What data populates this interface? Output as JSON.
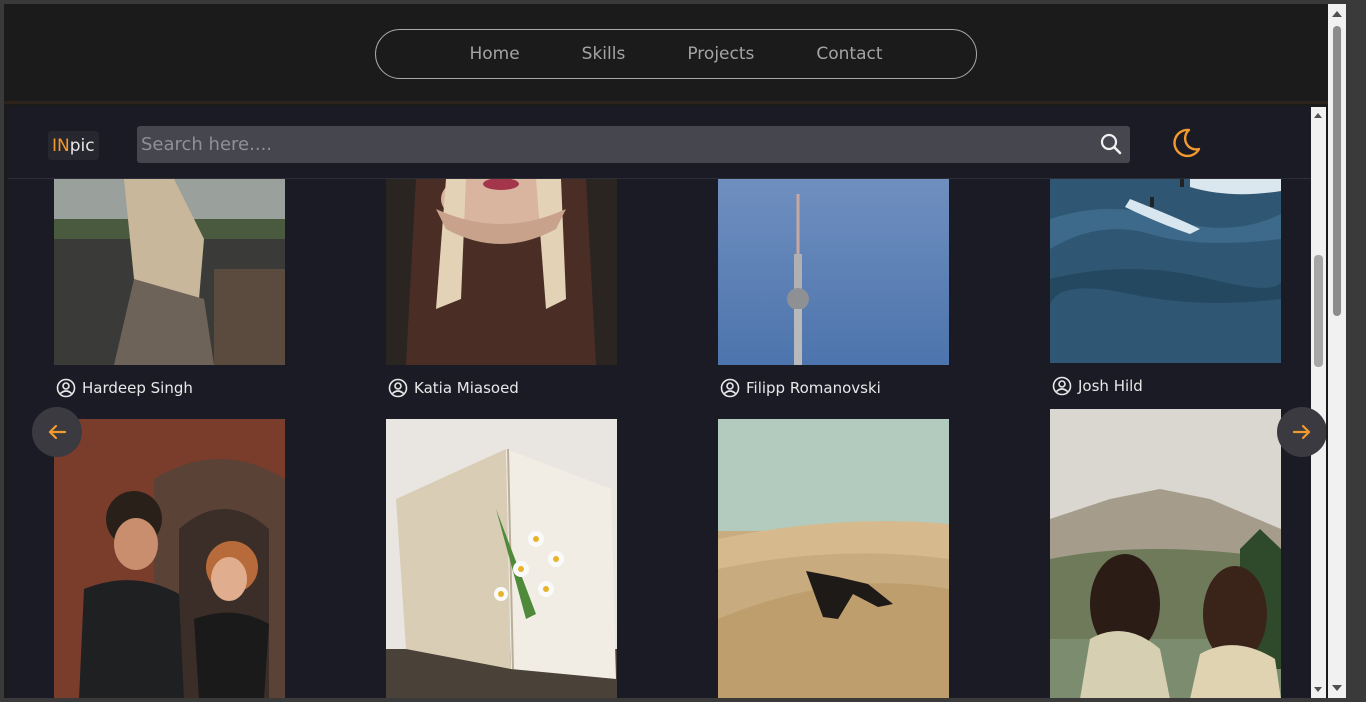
{
  "nav": {
    "items": [
      "Home",
      "Skills",
      "Projects",
      "Contact"
    ]
  },
  "logo": {
    "part1": "IN",
    "part2": "pic"
  },
  "search": {
    "placeholder": "Search here...."
  },
  "photos": [
    {
      "author": "Hardeep Singh"
    },
    {
      "author": "Katia Miasoed"
    },
    {
      "author": "Filipp Romanovski"
    },
    {
      "author": "Josh Hild"
    }
  ],
  "colors": {
    "accent": "#f29a2e",
    "background": "#1b1b26"
  },
  "icons": {
    "search": "search-icon",
    "theme": "moon-icon",
    "prev": "arrow-left-icon",
    "next": "arrow-right-icon",
    "user": "user-circle-icon"
  }
}
